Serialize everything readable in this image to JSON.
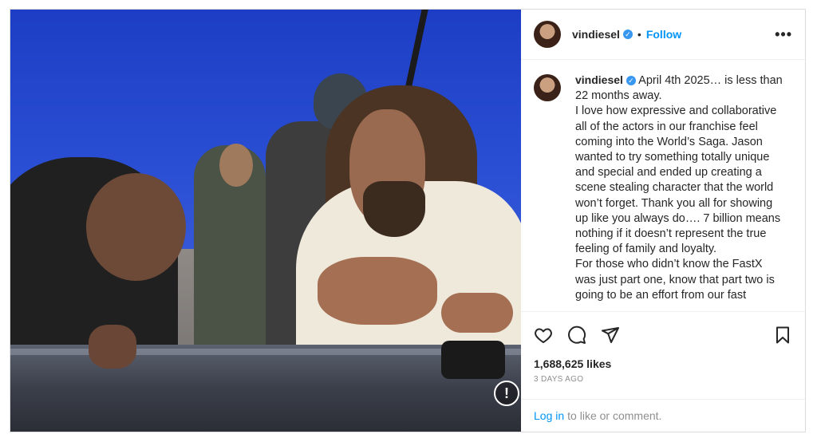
{
  "post": {
    "username": "vindiesel",
    "follow_label": "Follow",
    "dot": "•",
    "more_label": "•••",
    "caption": "April 4th 2025… is less than 22 months away.\nI love how expressive and collaborative all of the actors in our franchise feel coming into the World’s Saga. Jason wanted to try something totally unique and special and ended up creating a scene stealing character that the world won’t forget. Thank you all for showing up like you always do…. 7 billion means nothing if it doesn’t represent the true feeling of family and loyalty.\nFor those who didn’t know the FastX was just part one, know that part two is going to be an effort from our fast",
    "likes": "1,688,625 likes",
    "time_ago": "3 days ago",
    "login_link": "Log in",
    "login_rest": "to like or comment.",
    "alert_glyph": "!"
  },
  "icons": {
    "like": "heart-icon",
    "comment": "comment-icon",
    "share": "send-icon",
    "save": "bookmark-icon",
    "verified": "verified-badge-icon",
    "alert": "sensitive-content-icon"
  },
  "colors": {
    "accent": "#0095f6",
    "verified": "#3897f0",
    "muted": "#8e8e8e",
    "text": "#262626",
    "border": "#dbdbdb"
  }
}
